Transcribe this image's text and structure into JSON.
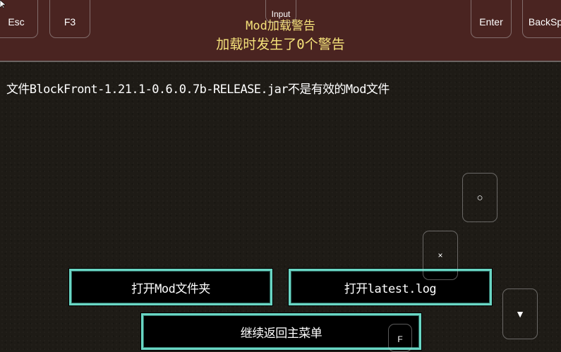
{
  "header": {
    "title": "Mod加载警告",
    "subtitle": "加载时发生了0个警告"
  },
  "message": "文件BlockFront-1.21.1-0.6.0.7b-RELEASE.jar不是有效的Mod文件",
  "buttons": {
    "open_mods": "打开Mod文件夹",
    "open_log": "打开latest.log",
    "continue": "继续返回主菜单"
  },
  "overlay_keys": {
    "esc": "Esc",
    "f3": "F3",
    "input": "Input",
    "enter": "Enter",
    "backsp": "BackSp",
    "circle": "○",
    "cross": "×",
    "down": "▼",
    "small": "F"
  },
  "colors": {
    "header_bg": "#4a2421",
    "title": "#f5e27a",
    "button_border": "#6ad6c4",
    "background": "#1e1b16"
  }
}
